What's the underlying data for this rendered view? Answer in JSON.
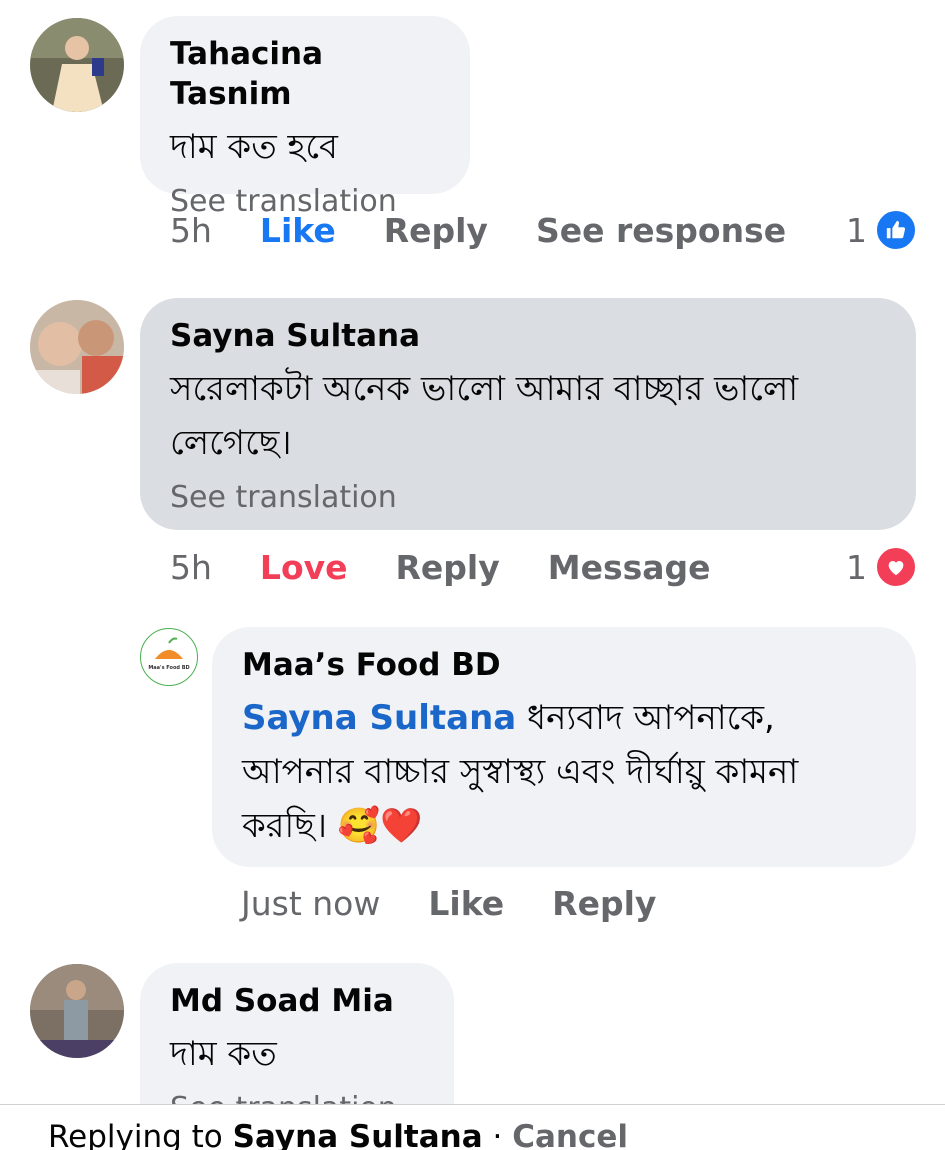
{
  "comments": [
    {
      "author": "Tahacina Tasnim",
      "text": "দাম কত হবে",
      "translate": "See translation",
      "time": "5h",
      "like": "Like",
      "reply": "Reply",
      "extra": "See response",
      "reaction_count": "1",
      "reaction_icon": "like-icon"
    },
    {
      "author": "Sayna Sultana",
      "text": "সরেলাকটা অনেক ভালো  আমার বাচ্ছার ভালো লেগেছে।",
      "translate": "See translation",
      "time": "5h",
      "like": "Love",
      "reply": "Reply",
      "extra": "Message",
      "reaction_count": "1",
      "reaction_icon": "love-icon"
    },
    {
      "author": "Md Soad Mia",
      "text": "দাম কত",
      "translate": "See translation"
    }
  ],
  "reply": {
    "author": "Maa’s Food BD",
    "logo_text": "Maa's Food BD",
    "mention": "Sayna Sultana",
    "text": " ধন্যবাদ আপনাকে, আপনার বাচ্চার সুস্বাস্থ্য এবং দীর্ঘায়ু কামনা করছি। ",
    "emoji": "🥰❤️",
    "time": "Just now",
    "like": "Like",
    "reply": "Reply"
  },
  "bottom_bar": {
    "prefix": "Replying to ",
    "name": "Sayna Sultana",
    "separator": " · ",
    "cancel": "Cancel"
  },
  "colors": {
    "like_blue": "#1877f2",
    "love_red": "#f33e58",
    "mention_blue": "#1a66c9",
    "bubble_bg": "#f0f2f5"
  }
}
